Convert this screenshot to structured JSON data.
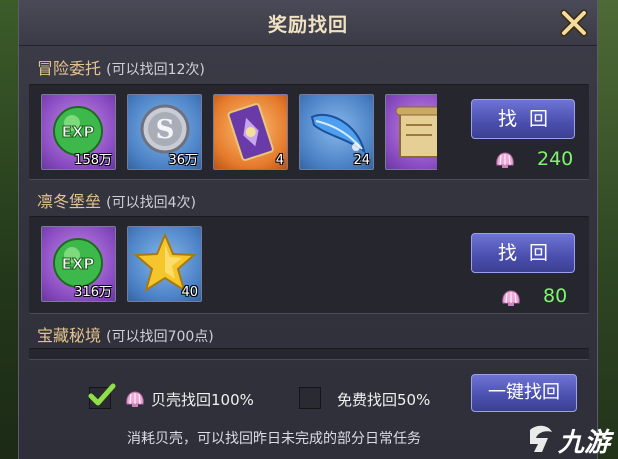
{
  "dialog": {
    "title": "奖励找回"
  },
  "sections": [
    {
      "name": "冒险委托",
      "note": "(可以找回12次)",
      "items": [
        {
          "icon": "exp-orb-icon",
          "qty": "158万",
          "quality": "purple"
        },
        {
          "icon": "silver-coin-icon",
          "qty": "36万",
          "quality": "blue"
        },
        {
          "icon": "card-pack-icon",
          "qty": "4",
          "quality": "orange"
        },
        {
          "icon": "feather-icon",
          "qty": "24",
          "quality": "blue"
        },
        {
          "icon": "scroll-icon",
          "qty": "",
          "quality": "purple"
        }
      ],
      "button": "找回",
      "cost": "240"
    },
    {
      "name": "凛冬堡垒",
      "note": "(可以找回4次)",
      "items": [
        {
          "icon": "exp-orb-icon",
          "qty": "316万",
          "quality": "purple"
        },
        {
          "icon": "gold-star-icon",
          "qty": "40",
          "quality": "blue"
        }
      ],
      "button": "找回",
      "cost": "80"
    },
    {
      "name": "宝藏秘境",
      "note": "(可以找回700点)"
    }
  ],
  "footer": {
    "shell_option": "贝壳找回100%",
    "shell_checked": true,
    "free_option": "免费找回50%",
    "free_checked": false,
    "one_click_button": "一键找回",
    "hint": "消耗贝壳，可以找回昨日未完成的部分日常任务"
  },
  "watermark": "九游",
  "colors": {
    "title": "#f1e3c2",
    "section": "#e3c48e",
    "cost": "#7df56c",
    "button": "#4a4fae"
  }
}
